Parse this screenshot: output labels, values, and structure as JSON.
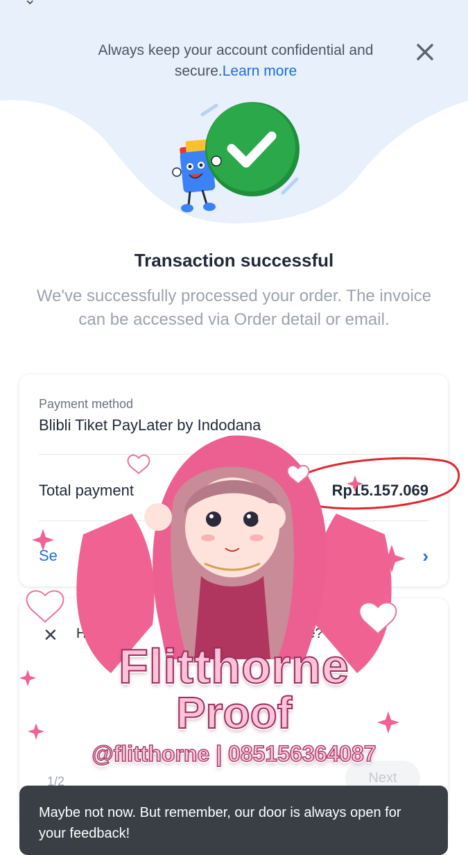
{
  "banner": {
    "text": "Always keep your account confidential and secure.",
    "link": "Learn more"
  },
  "title": "Transaction successful",
  "subtitle": "We've successfully processed your order. The invoice can be accessed via Order detail or email.",
  "payment": {
    "method_label": "Payment method",
    "method_value": "Blibli Tiket PayLater by Indodana",
    "total_label": "Total payment",
    "total_value": "Rp15.157.069",
    "see_link": "Se"
  },
  "feedback": {
    "question_start": "How",
    "question_end": "ence?",
    "page_indicator": "1/2",
    "next_label": "Next"
  },
  "toast": {
    "text": "Maybe not now. But remember, our door is always open for your feedback!"
  },
  "watermark": {
    "line1": "Flitthorne",
    "line2": "Proof",
    "line3": "@flitthorne | 085156364087"
  },
  "colors": {
    "accent": "#1e6fe0",
    "success": "#2aa84a",
    "banner_bg": "#e7f0fb",
    "annotation": "#e0262f",
    "watermark_pink": "#ffc3da"
  },
  "icons": {
    "close": "close-icon",
    "success": "checkmark-circle-icon",
    "chevron": "chevron-right-icon"
  }
}
